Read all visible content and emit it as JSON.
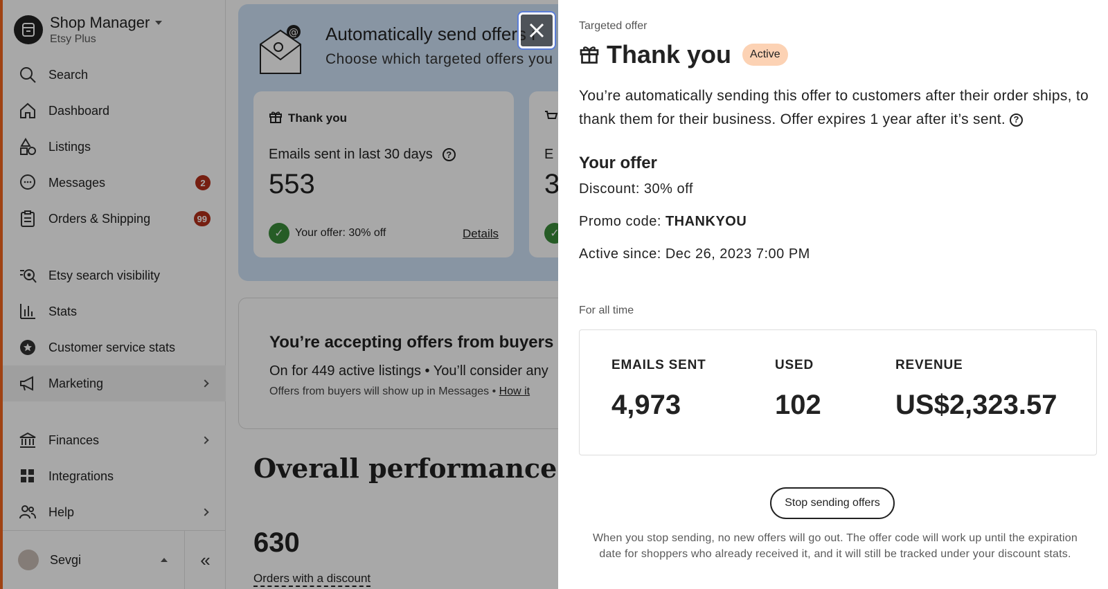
{
  "sidebar": {
    "shop_title": "Shop Manager",
    "shop_sub": "Etsy Plus",
    "items": [
      {
        "label": "Search"
      },
      {
        "label": "Dashboard"
      },
      {
        "label": "Listings"
      },
      {
        "label": "Messages",
        "badge": "2"
      },
      {
        "label": "Orders & Shipping",
        "badge": "99"
      },
      {
        "label": "Etsy search visibility"
      },
      {
        "label": "Stats"
      },
      {
        "label": "Customer service stats"
      },
      {
        "label": "Marketing"
      },
      {
        "label": "Finances"
      },
      {
        "label": "Integrations"
      },
      {
        "label": "Help"
      }
    ],
    "user_name": "Sevgi",
    "collapse_glyph": "«"
  },
  "main": {
    "banner_title": "Automatically send offers i",
    "banner_sub": "Choose which targeted offers you",
    "card1": {
      "title": "Thank you",
      "label": "Emails sent in last 30 days",
      "value": "553",
      "offer": "Your offer: 30% off",
      "details": "Details"
    },
    "card2": {
      "label_fragment": "E",
      "value_fragment": "3"
    },
    "accept_title": "You’re accepting offers from buyers",
    "accept_sub": "On for 449 active listings • You’ll consider any",
    "accept_small": "Offers from buyers will show up in Messages • ",
    "accept_link": "How it",
    "perf_title": "Overall performance",
    "perf_value": "630",
    "perf_label": "Orders with a discount"
  },
  "panel": {
    "eyebrow": "Targeted offer",
    "title": "Thank you",
    "status": "Active",
    "description": "You’re automatically sending this offer to customers after their order ships, to thank them for their business. Offer expires 1 year after it’s sent.",
    "offer_heading": "Your offer",
    "discount": "Discount: 30% off",
    "promo_label": "Promo code: ",
    "promo_code": "THANKYOU",
    "active_since": "Active since: Dec 26, 2023 7:00 PM",
    "period": "For all time",
    "stats": [
      {
        "label": "EMAILS SENT",
        "value": "4,973"
      },
      {
        "label": "USED",
        "value": "102"
      },
      {
        "label": "REVENUE",
        "value": "US$2,323.57"
      }
    ],
    "stop_button": "Stop sending offers",
    "note": "When you stop sending, no new offers will go out. The offer code will work up until the expiration date for shoppers who already received it, and it will still be tracked under your discount stats."
  },
  "colors": {
    "accent_edge": "#f1641e",
    "badge_red": "#b42f1a",
    "active_badge": "#fcd2b4",
    "banner_blue": "#cfe2f7",
    "check_green": "#3a8c3a"
  }
}
